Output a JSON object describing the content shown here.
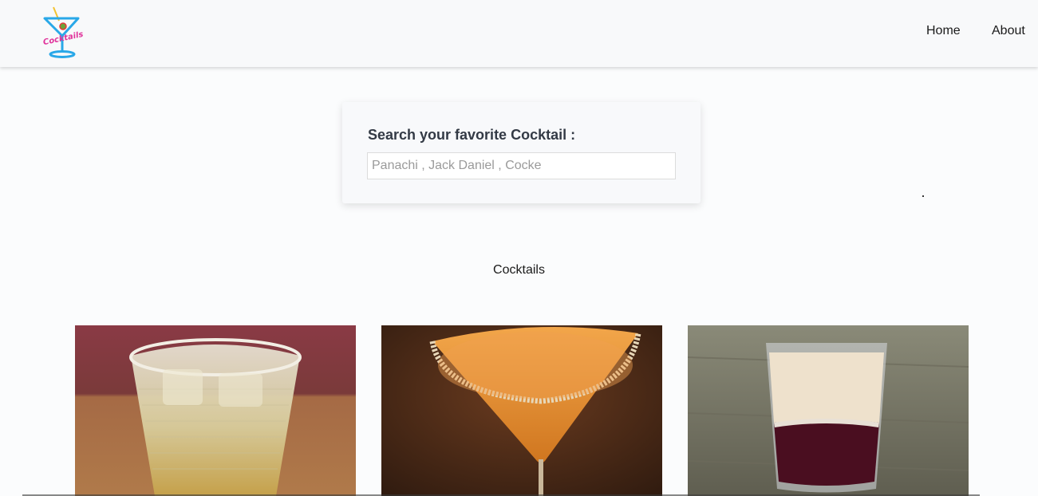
{
  "nav": {
    "logo_icon": "cocktail-neon-logo",
    "home_label": "Home",
    "about_label": "About"
  },
  "search": {
    "label": "Search your favorite Cocktail :",
    "placeholder": "Panachi , Jack Daniel , Cocke",
    "value": ""
  },
  "section": {
    "title": "Cocktails"
  },
  "cards": [
    {
      "image": "whiskey-on-ice-glass-photo"
    },
    {
      "image": "orange-martini-sugar-rim-photo"
    },
    {
      "image": "layered-shot-glass-photo"
    }
  ],
  "colors": {
    "navbar_bg": "#f8f9fa",
    "page_bg": "#fbfcfd",
    "logo_neon_blue": "#29a8e8",
    "logo_neon_pink": "#e0339b"
  }
}
